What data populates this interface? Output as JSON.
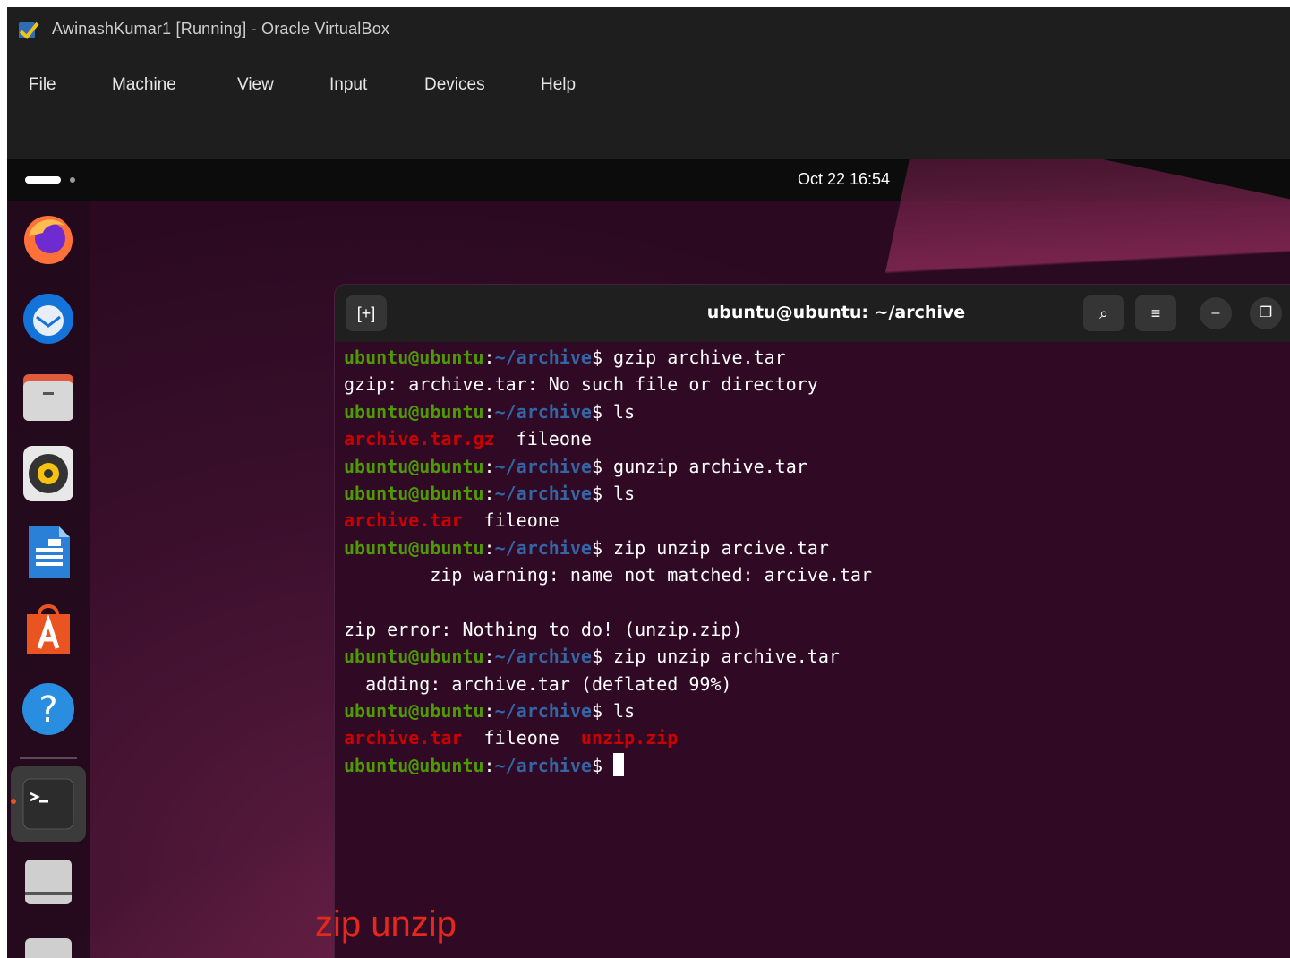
{
  "window": {
    "title": "AwinashKumar1 [Running] - Oracle VirtualBox",
    "menu": [
      "File",
      "Machine",
      "View",
      "Input",
      "Devices",
      "Help"
    ]
  },
  "topbar": {
    "clock": "Oct 22  16:54"
  },
  "dock": {
    "apps": [
      "firefox-icon",
      "thunderbird-icon",
      "files-icon",
      "rhythmbox-icon",
      "libreoffice-writer-icon",
      "app-center-icon",
      "help-icon",
      "terminal-icon",
      "drive-icon",
      "drive-icon"
    ]
  },
  "terminal": {
    "title": "ubuntu@ubuntu: ~/archive",
    "new_tab_glyph": "[+]",
    "search_glyph": "⌕",
    "menu_glyph": "≡",
    "minimize_glyph": "–",
    "maximize_glyph": "❐",
    "prompt_user": "ubuntu@ubuntu",
    "prompt_sep": ":",
    "prompt_path": "~/archive",
    "prompt_dollar": "$",
    "lines": [
      {
        "type": "cmd",
        "text": " gzip archive.tar"
      },
      {
        "type": "out",
        "text": "gzip: archive.tar: No such file or directory"
      },
      {
        "type": "cmd",
        "text": " ls"
      },
      {
        "type": "ls",
        "items": [
          {
            "text": "archive.tar.gz",
            "red": true
          },
          {
            "text": "  fileone",
            "red": false
          }
        ]
      },
      {
        "type": "cmd",
        "text": " gunzip archive.tar"
      },
      {
        "type": "cmd",
        "text": " ls"
      },
      {
        "type": "ls",
        "items": [
          {
            "text": "archive.tar",
            "red": true
          },
          {
            "text": "  fileone",
            "red": false
          }
        ]
      },
      {
        "type": "cmd",
        "text": " zip unzip arcive.tar"
      },
      {
        "type": "out",
        "text": "        zip warning: name not matched: arcive.tar"
      },
      {
        "type": "out",
        "text": ""
      },
      {
        "type": "out",
        "text": "zip error: Nothing to do! (unzip.zip)"
      },
      {
        "type": "cmd",
        "text": " zip unzip archive.tar"
      },
      {
        "type": "out",
        "text": "  adding: archive.tar (deflated 99%)"
      },
      {
        "type": "cmd",
        "text": " ls"
      },
      {
        "type": "ls",
        "items": [
          {
            "text": "archive.tar",
            "red": true
          },
          {
            "text": "  fileone  ",
            "red": false
          },
          {
            "text": "unzip.zip",
            "red": true
          }
        ]
      },
      {
        "type": "prompt",
        "text": " "
      }
    ]
  },
  "annotation": {
    "text": "zip unzip",
    "color": "#e4281c"
  },
  "colors": {
    "prompt_user": "#4e9a06",
    "prompt_path": "#3465a4",
    "archive_red": "#cc0000",
    "terminal_bg": "#300a24"
  }
}
